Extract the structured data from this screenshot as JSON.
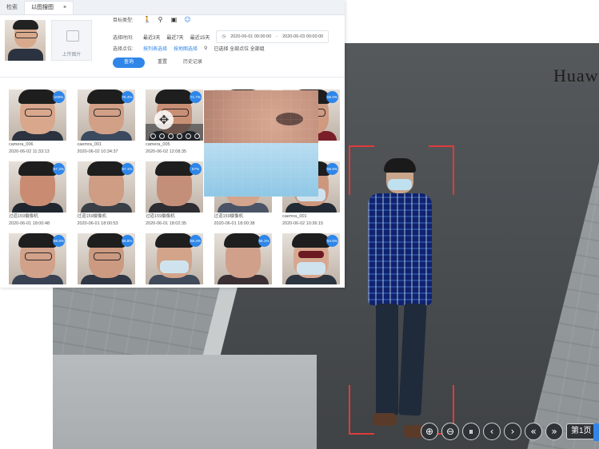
{
  "tabs": [
    {
      "label": "检索"
    },
    {
      "label": "以图搜图",
      "close": "×"
    }
  ],
  "query": {
    "upload_label": "上传图片",
    "target_type_label": "目标类型:",
    "time_label": "选择时间:",
    "time_options": [
      "最近3天",
      "最近7天",
      "最近15天"
    ],
    "date_start": "2020-06-01 00:00:00",
    "date_sep": "-",
    "date_end": "2020-06-03 00:00:00",
    "location_label": "选择点位:",
    "location_links": [
      "按列表选择",
      "按地图选择"
    ],
    "location_status": "已选择 全部点位 全部组",
    "search_button": "查询",
    "reset_button": "重置",
    "history_button": "历史记录"
  },
  "results": [
    {
      "score": "100%",
      "camera": "camera_006",
      "time": "2020-06-02 11:33:13"
    },
    {
      "score": "75.4%",
      "camera": "caemra_001",
      "time": "2020-06-02 10:34:37"
    },
    {
      "score": "71.7%",
      "camera": "camera_005",
      "time": "2020-06-02 12:08:35"
    },
    {
      "score": "",
      "camera": "",
      "time": ""
    },
    {
      "score": "66.0%",
      "camera": "",
      "time": "01:15"
    },
    {
      "score": "67.2%",
      "camera": "过道159摄像机",
      "time": "2020-06-01 18:00:48"
    },
    {
      "score": "57.1%",
      "camera": "过道159摄像机",
      "time": "2020-06-01 18:00:53"
    },
    {
      "score": "57%",
      "camera": "过道159摄像机",
      "time": "2020-06-01 18:02:35"
    },
    {
      "score": "",
      "camera": "过道159摄像机",
      "time": "2020-06-01 18:00:38"
    },
    {
      "score": "56.6%",
      "camera": "caemra_001",
      "time": "2020-06-02 10:36:15"
    },
    {
      "score": "55.8%",
      "camera": "",
      "time": ""
    },
    {
      "score": "55.8%",
      "camera": "",
      "time": ""
    },
    {
      "score": "55.4%",
      "camera": "",
      "time": ""
    },
    {
      "score": "55.1%",
      "camera": "",
      "time": ""
    },
    {
      "score": "54.6%",
      "camera": "",
      "time": ""
    }
  ],
  "video": {
    "sign_text": "Huaw",
    "controls": [
      "⊕",
      "⊖",
      "⏸",
      "‹",
      "›",
      "«",
      "»"
    ],
    "page_label": "第1页"
  },
  "colors": {
    "accent": "#2f86e8",
    "detect_box": "#e03a3a"
  }
}
